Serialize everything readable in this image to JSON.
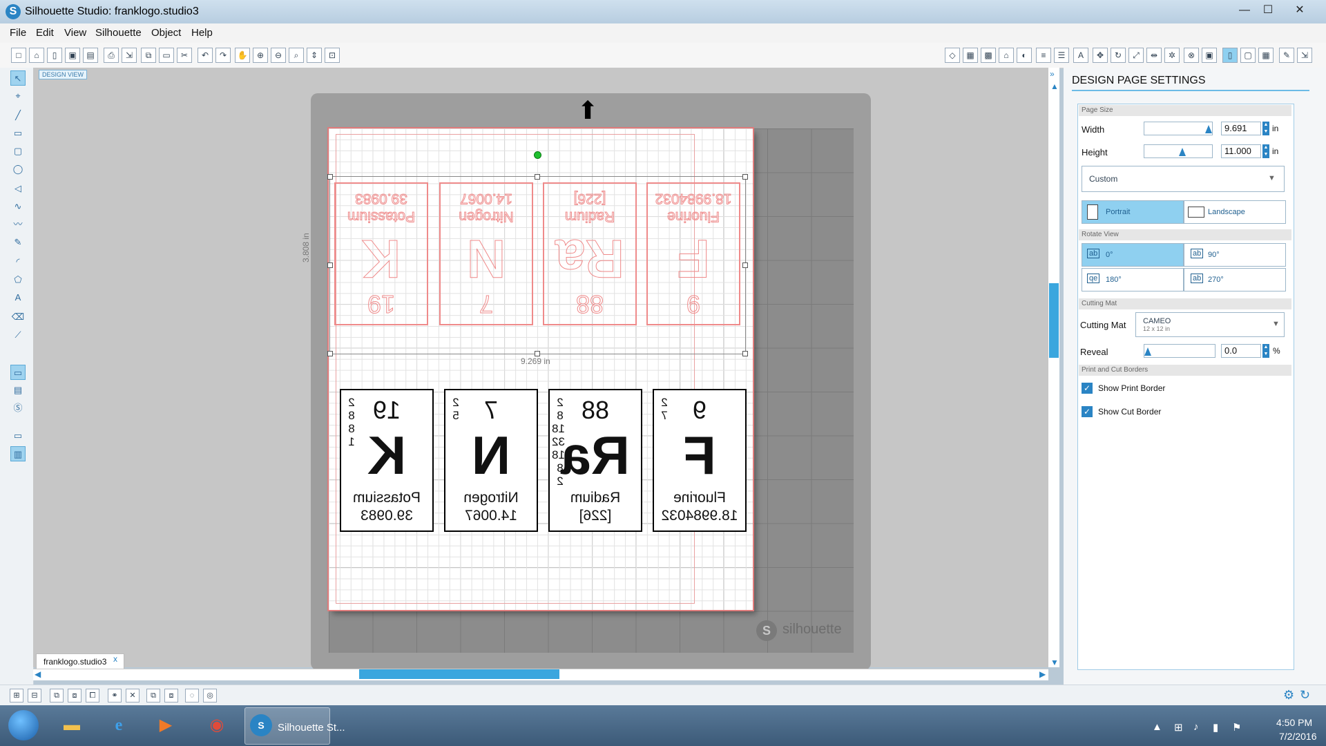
{
  "app": {
    "title": "Silhouette Studio: franklogo.studio3",
    "logo_letter": "S"
  },
  "window_controls": {
    "minimize": "—",
    "maximize": "☐",
    "close": "✕"
  },
  "menu": [
    "File",
    "Edit",
    "View",
    "Silhouette",
    "Object",
    "Help"
  ],
  "canvas": {
    "design_view_tag": "DESIGN VIEW",
    "dimension_width": "9.269 in",
    "dimension_height": "3.808 in",
    "watermark": "silhouette"
  },
  "elements": [
    {
      "number": "19",
      "symbol": "K",
      "shells": [
        "2",
        "8",
        "8",
        "1"
      ],
      "name": "Potassium",
      "mass": "39.0983"
    },
    {
      "number": "7",
      "symbol": "N",
      "shells": [
        "2",
        "5"
      ],
      "name": "Nitrogen",
      "mass": "14.0067"
    },
    {
      "number": "88",
      "symbol": "Ra",
      "shells": [
        "2",
        "8",
        "18",
        "32",
        "18",
        "8",
        "2"
      ],
      "name": "Radium",
      "mass": "[226]"
    },
    {
      "number": "9",
      "symbol": "F",
      "shells": [
        "2",
        "7"
      ],
      "name": "Fluorine",
      "mass": "18.9984032"
    }
  ],
  "document_tab": {
    "label": "franklogo.studio3",
    "close": "x"
  },
  "panel": {
    "title": "DESIGN PAGE SETTINGS",
    "page_size": {
      "header": "Page Size",
      "width_label": "Width",
      "width_value": "9.691",
      "width_unit": "in",
      "height_label": "Height",
      "height_value": "11.000",
      "height_unit": "in",
      "preset": "Custom"
    },
    "orientation": {
      "portrait": "Portrait",
      "landscape": "Landscape",
      "selected": "Portrait"
    },
    "rotate_view": {
      "header": "Rotate View",
      "options": [
        "0°",
        "90°",
        "180°",
        "270°"
      ],
      "selected": "0°"
    },
    "cutting_mat": {
      "header": "Cutting Mat",
      "label": "Cutting Mat",
      "value": "CAMEO",
      "subvalue": "12 x 12 in",
      "reveal_label": "Reveal",
      "reveal_value": "0.0",
      "reveal_unit": "%"
    },
    "borders": {
      "header": "Print and Cut Borders",
      "print": "Show Print Border",
      "cut": "Show Cut Border",
      "print_checked": true,
      "cut_checked": true
    }
  },
  "taskbar": {
    "active_app": "Silhouette St...",
    "time": "4:50 PM",
    "date": "7/2/2016"
  },
  "colors": {
    "accent": "#2a84c4",
    "cut_line": "#ef8a8a",
    "selection_active": "#8fd0f0"
  }
}
